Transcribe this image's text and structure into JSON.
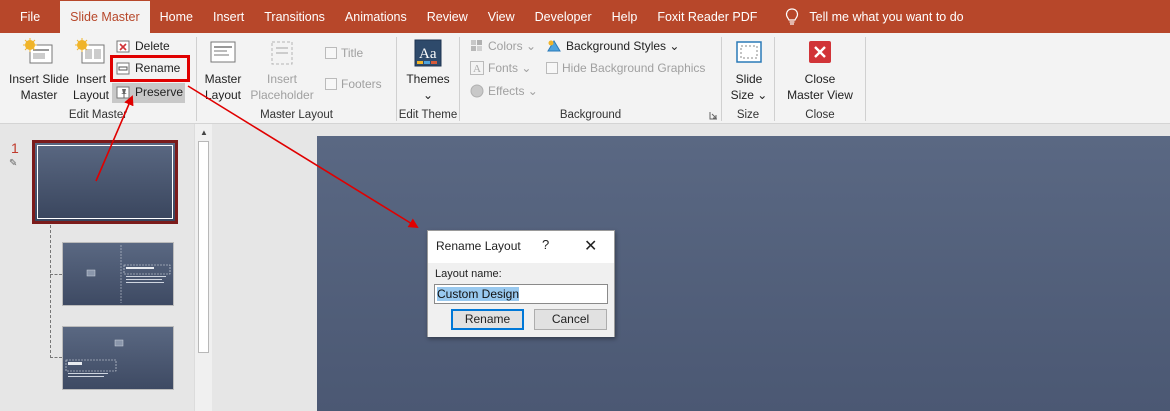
{
  "tabs": [
    "File",
    "Slide Master",
    "Home",
    "Insert",
    "Transitions",
    "Animations",
    "Review",
    "View",
    "Developer",
    "Help",
    "Foxit Reader PDF"
  ],
  "tell_me": "Tell me what you want to do",
  "ribbon": {
    "edit_master": {
      "label": "Edit Master",
      "insert_slide_master": [
        "Insert Slide",
        "Master"
      ],
      "insert_layout": [
        "Insert",
        "Layout"
      ],
      "delete": "Delete",
      "rename": "Rename",
      "preserve": "Preserve"
    },
    "master_layout": {
      "label": "Master Layout",
      "master_layout_btn": [
        "Master",
        "Layout"
      ],
      "insert_placeholder": [
        "Insert",
        "Placeholder ⌄"
      ],
      "title": "Title",
      "footers": "Footers"
    },
    "edit_theme": {
      "label": "Edit Theme",
      "themes": "Themes",
      "themes_caret": "⌄"
    },
    "background": {
      "label": "Background",
      "colors": "Colors ⌄",
      "fonts": "Fonts ⌄",
      "effects": "Effects ⌄",
      "background_styles": "Background Styles ⌄",
      "hide_background_graphics": "Hide Background Graphics"
    },
    "size": {
      "label": "Size",
      "slide_size": [
        "Slide",
        "Size ⌄"
      ]
    },
    "close": {
      "label": "Close",
      "close_master_view": [
        "Close",
        "Master View"
      ]
    }
  },
  "slide_panel": {
    "master_number": "1"
  },
  "dialog": {
    "title": "Rename Layout",
    "help": "?",
    "close": "✕",
    "label": "Layout name:",
    "value": "Custom Design",
    "rename_button": "Rename",
    "cancel_button": "Cancel"
  },
  "colors": {
    "tabbar": "#b7472a",
    "annotation": "#e00000",
    "slide": "#4f5c77"
  }
}
